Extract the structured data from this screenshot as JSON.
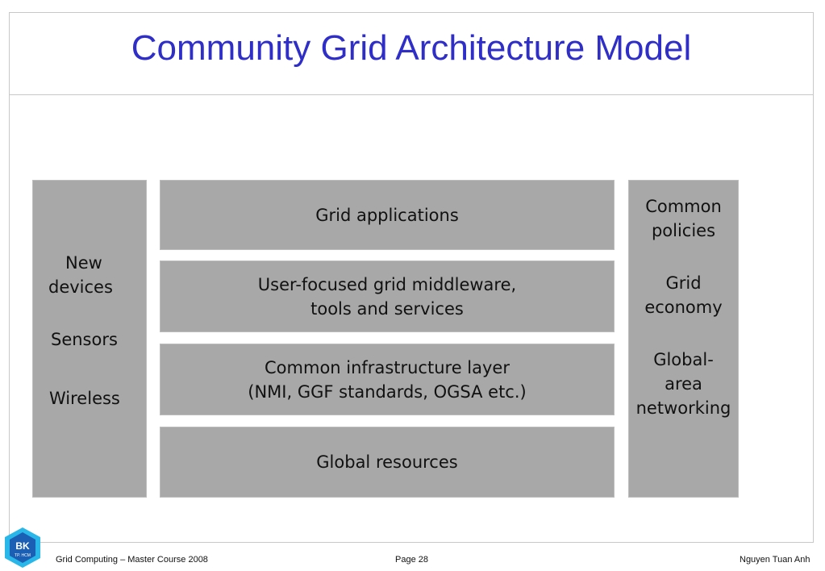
{
  "slide": {
    "title": "Community Grid Architecture Model"
  },
  "diagram": {
    "left_column": {
      "items": [
        {
          "lines": [
            "New",
            "devices"
          ]
        },
        {
          "lines": [
            "Sensors"
          ]
        },
        {
          "lines": [
            "Wireless"
          ]
        }
      ]
    },
    "layers": [
      {
        "lines": [
          "Grid applications"
        ]
      },
      {
        "lines": [
          "User-focused grid middleware,",
          "tools and services"
        ]
      },
      {
        "lines": [
          "Common infrastructure layer",
          "(NMI, GGF standards, OGSA etc.)"
        ]
      },
      {
        "lines": [
          "Global resources"
        ]
      }
    ],
    "right_column": {
      "items": [
        {
          "lines": [
            "Common",
            "policies"
          ]
        },
        {
          "lines": [
            "Grid",
            "economy"
          ]
        },
        {
          "lines": [
            "Global-",
            "area",
            "networking"
          ]
        }
      ]
    }
  },
  "footer": {
    "course": "Grid Computing – Master Course  2008",
    "page": "Page 28",
    "author": "Nguyen Tuan Anh",
    "logo_text_top": "BK",
    "logo_text_bottom": "TP. HCM"
  },
  "colors": {
    "title": "#2f2fc8",
    "box_fill": "#a8a8a8",
    "logo_blue": "#1a5fb4",
    "logo_cyan": "#29b6e8"
  }
}
